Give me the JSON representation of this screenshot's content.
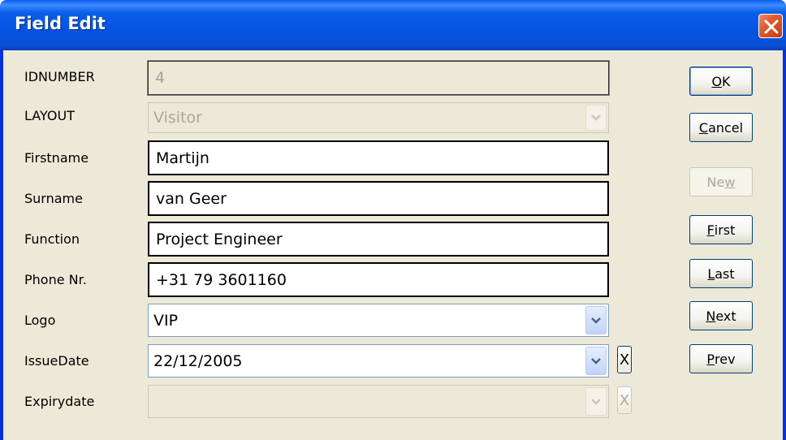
{
  "window": {
    "title": "Field Edit"
  },
  "fields": [
    {
      "key": "idnumber",
      "label": "IDNUMBER",
      "value": "4"
    },
    {
      "key": "layout",
      "label": "LAYOUT",
      "value": "Visitor"
    },
    {
      "key": "firstname",
      "label": "Firstname",
      "value": "Martijn"
    },
    {
      "key": "surname",
      "label": "Surname",
      "value": "van Geer"
    },
    {
      "key": "function",
      "label": "Function",
      "value": "Project Engineer"
    },
    {
      "key": "phone",
      "label": "Phone Nr.",
      "value": "+31 79 3601160"
    },
    {
      "key": "logo",
      "label": "Logo",
      "value": "VIP"
    },
    {
      "key": "issuedate",
      "label": "IssueDate",
      "value": "22/12/2005"
    },
    {
      "key": "expirydate",
      "label": "Expirydate",
      "value": ""
    }
  ],
  "clear_button_label": "X",
  "buttons": {
    "ok": {
      "mnemonic": "O",
      "rest": "K"
    },
    "cancel": {
      "mnemonic": "C",
      "rest": "ancel"
    },
    "new": {
      "pre": "Ne",
      "mnemonic": "w"
    },
    "first": {
      "mnemonic": "F",
      "rest": "irst"
    },
    "last": {
      "mnemonic": "L",
      "rest": "ast"
    },
    "next": {
      "mnemonic": "N",
      "rest": "ext"
    },
    "prev": {
      "mnemonic": "P",
      "rest": "rev"
    }
  },
  "colors": {
    "title_bar": "#0553e0",
    "dialog_bg": "#ece9d8",
    "close_button": "#e05a30"
  }
}
